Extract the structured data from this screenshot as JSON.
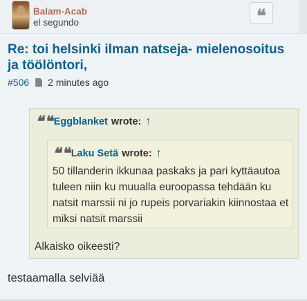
{
  "post": {
    "author": "Balam-Acab",
    "rank": "el segundo",
    "quote_icon": "❝",
    "title": "Re: toi helsinki ilman natseja- mielenosoitus ja töölöntori,",
    "post_number": "#506",
    "time": "2 minutes ago",
    "outer_quote": {
      "author": "Eggblanket",
      "wrote": "wrote:",
      "arrow": "↑",
      "inner_quote": {
        "author": "Laku Setä",
        "wrote": "wrote:",
        "arrow": "↑",
        "text": "50 tillanderin ikkunaa paskaks ja pari kyttäautoa tuleen niin ku muualla euroopassa tehdään ku natsit marssii ni jo rupeis porvariakin kiinnostaa et miksi natsit marssii"
      },
      "text": "Alkaisko oikeesti?"
    },
    "reply": "testaamalla selviää"
  },
  "colors": {
    "link": "#0b5f90",
    "author": "#b36c58",
    "quote_bg": "#eceedd"
  }
}
